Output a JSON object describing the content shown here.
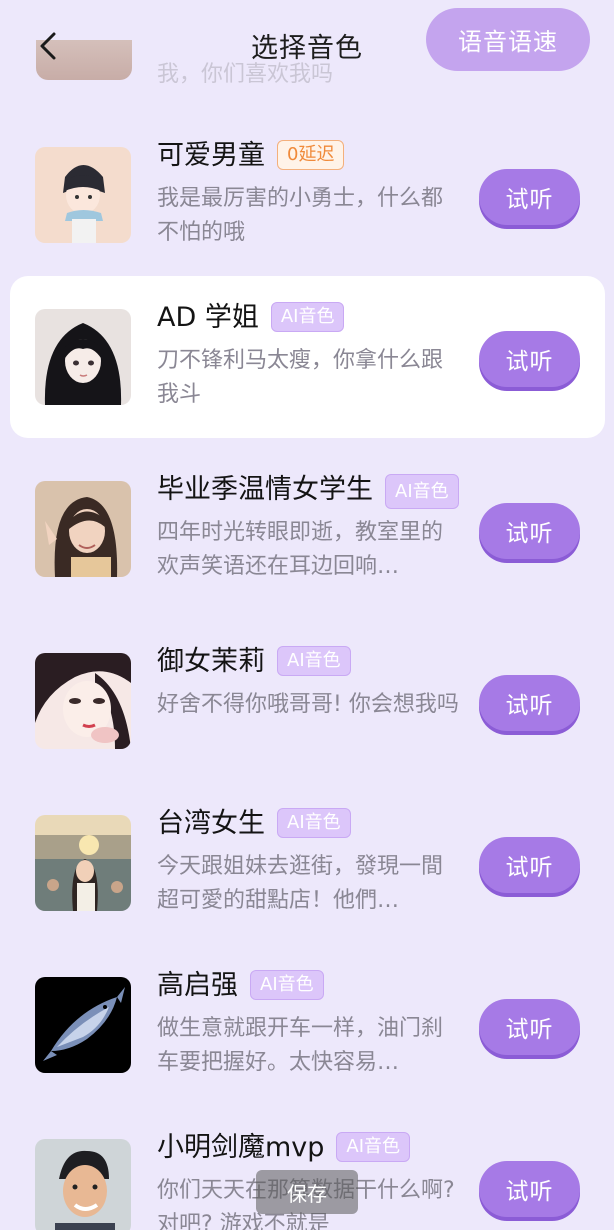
{
  "header": {
    "title": "选择音色",
    "speed_button": "语音语速"
  },
  "partial_top_desc": "我，你们喜欢我吗",
  "voices": [
    {
      "name": "可爱男童",
      "tag": "0延迟",
      "desc": "我是最厉害的小勇士，什么都不怕的哦",
      "listen": "试听"
    },
    {
      "name": "AD 学姐",
      "tag": "AI音色",
      "desc": "刀不锋利马太瘦，你拿什么跟我斗",
      "listen": "试听"
    },
    {
      "name": "毕业季温情女学生",
      "tag": "AI音色",
      "desc": "四年时光转眼即逝，教室里的欢声笑语还在耳边回响…",
      "listen": "试听"
    },
    {
      "name": "御女茉莉",
      "tag": "AI音色",
      "desc": "好舍不得你哦哥哥! 你会想我吗",
      "listen": "试听"
    },
    {
      "name": "台湾女生",
      "tag": "AI音色",
      "desc": "今天跟姐妹去逛街，發現一間超可愛的甜點店！他們…",
      "listen": "试听"
    },
    {
      "name": "高启强",
      "tag": "AI音色",
      "desc": "做生意就跟开车一样，油门刹车要把握好。太快容易…",
      "listen": "试听"
    },
    {
      "name": "小明剑魔mvp",
      "tag": "AI音色",
      "desc": "你们天天在那算数据干什么啊? 对吧? 游戏不就是",
      "listen": "试听"
    }
  ],
  "toast": "保存"
}
